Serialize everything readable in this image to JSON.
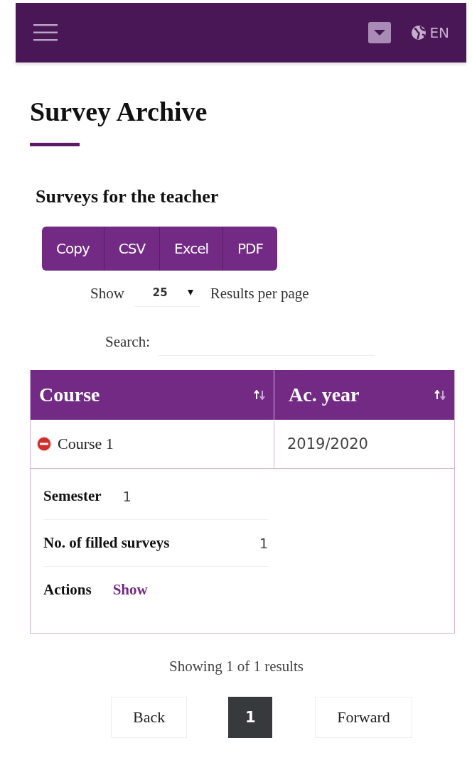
{
  "header": {
    "language": "EN"
  },
  "page_title": "Survey Archive",
  "section_title": "Surveys for the teacher",
  "export_buttons": [
    "Copy",
    "CSV",
    "Excel",
    "PDF"
  ],
  "length": {
    "label": "Show",
    "value": "25",
    "suffix": "Results per page"
  },
  "search": {
    "label": "Search:"
  },
  "table": {
    "columns": [
      "Course",
      "Ac. year"
    ],
    "rows": [
      {
        "course": "Course 1",
        "year": "2019/2020",
        "expanded": true,
        "details": [
          {
            "label": "Semester",
            "value": "1",
            "kind": "text"
          },
          {
            "label": "No. of filled surveys",
            "value": "1",
            "kind": "text"
          },
          {
            "label": "Actions",
            "value": "Show",
            "kind": "link"
          }
        ]
      }
    ]
  },
  "info": "Showing 1 of 1 results",
  "pagination": {
    "back": "Back",
    "pages": [
      {
        "label": "1",
        "selected": true
      }
    ],
    "forward": "Forward"
  }
}
